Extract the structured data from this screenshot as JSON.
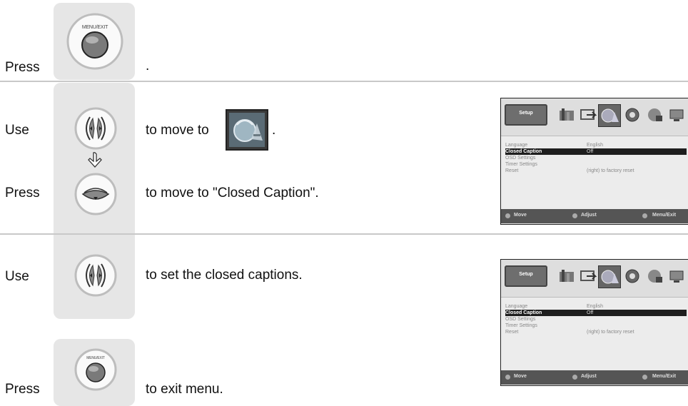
{
  "steps": [
    {
      "label": "Press",
      "button": "MENU/EXIT",
      "text": "."
    },
    {
      "label": "Use",
      "text_before": "to move to",
      "text_after": "."
    },
    {
      "label": "Press",
      "text": "to move to \"Closed Caption\"."
    },
    {
      "label": "Use",
      "text": "to set the closed captions."
    },
    {
      "label": "Press",
      "button": "MENU/EXIT",
      "text": "to exit menu."
    }
  ],
  "osd": {
    "tab": "Setup",
    "rows": [
      {
        "name": "Language",
        "value": "English"
      },
      {
        "name": "Closed Caption",
        "value": "Off"
      },
      {
        "name": "OSD Settings",
        "value": ""
      },
      {
        "name": "Timer Settings",
        "value": ""
      },
      {
        "name": "Reset",
        "value": "(right) to factory reset"
      }
    ],
    "footer": {
      "move": "Move",
      "adjust": "Adjust",
      "menu": "Menu/Exit"
    }
  },
  "icons": [
    "arrow-hand-icon",
    "menu-exit-button-icon",
    "left-right-button-icon",
    "down-button-icon",
    "setup-menu-icon"
  ]
}
